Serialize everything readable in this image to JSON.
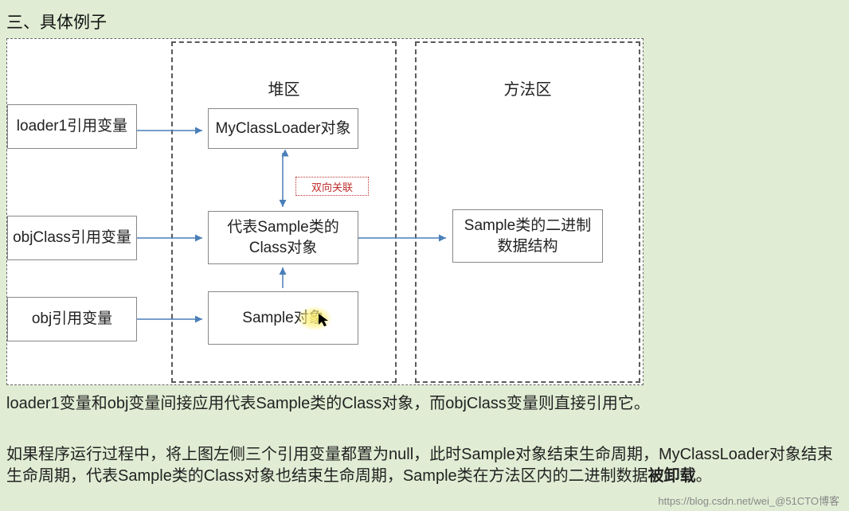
{
  "heading": "三、具体例子",
  "regions": {
    "heap": "堆区",
    "method": "方法区"
  },
  "boxes": {
    "loader1": "loader1引用变量",
    "objclass": "objClass引用变量",
    "obj": "obj引用变量",
    "mcl": "MyClassLoader对象",
    "classobj_l1": "代表Sample类的",
    "classobj_l2": "Class对象",
    "sampleobj": "Sample对象",
    "binary_l1": "Sample类的二进制",
    "binary_l2": "数据结构"
  },
  "assoc": "双向关联",
  "para1": "loader1变量和obj变量间接应用代表Sample类的Class对象，而objClass变量则直接引用它。",
  "para2_a": "如果程序运行过程中，将上图左侧三个引用变量都置为null，此时Sample对象结束生命周期，MyClassLoader对象结束生命周期，代表Sample类的Class对象也结束生命周期，Sample类在方法区内的二进制数据",
  "para2_b": "被卸载",
  "para2_c": "。",
  "watermark": "https://blog.csdn.net/wei_@51CTO博客"
}
